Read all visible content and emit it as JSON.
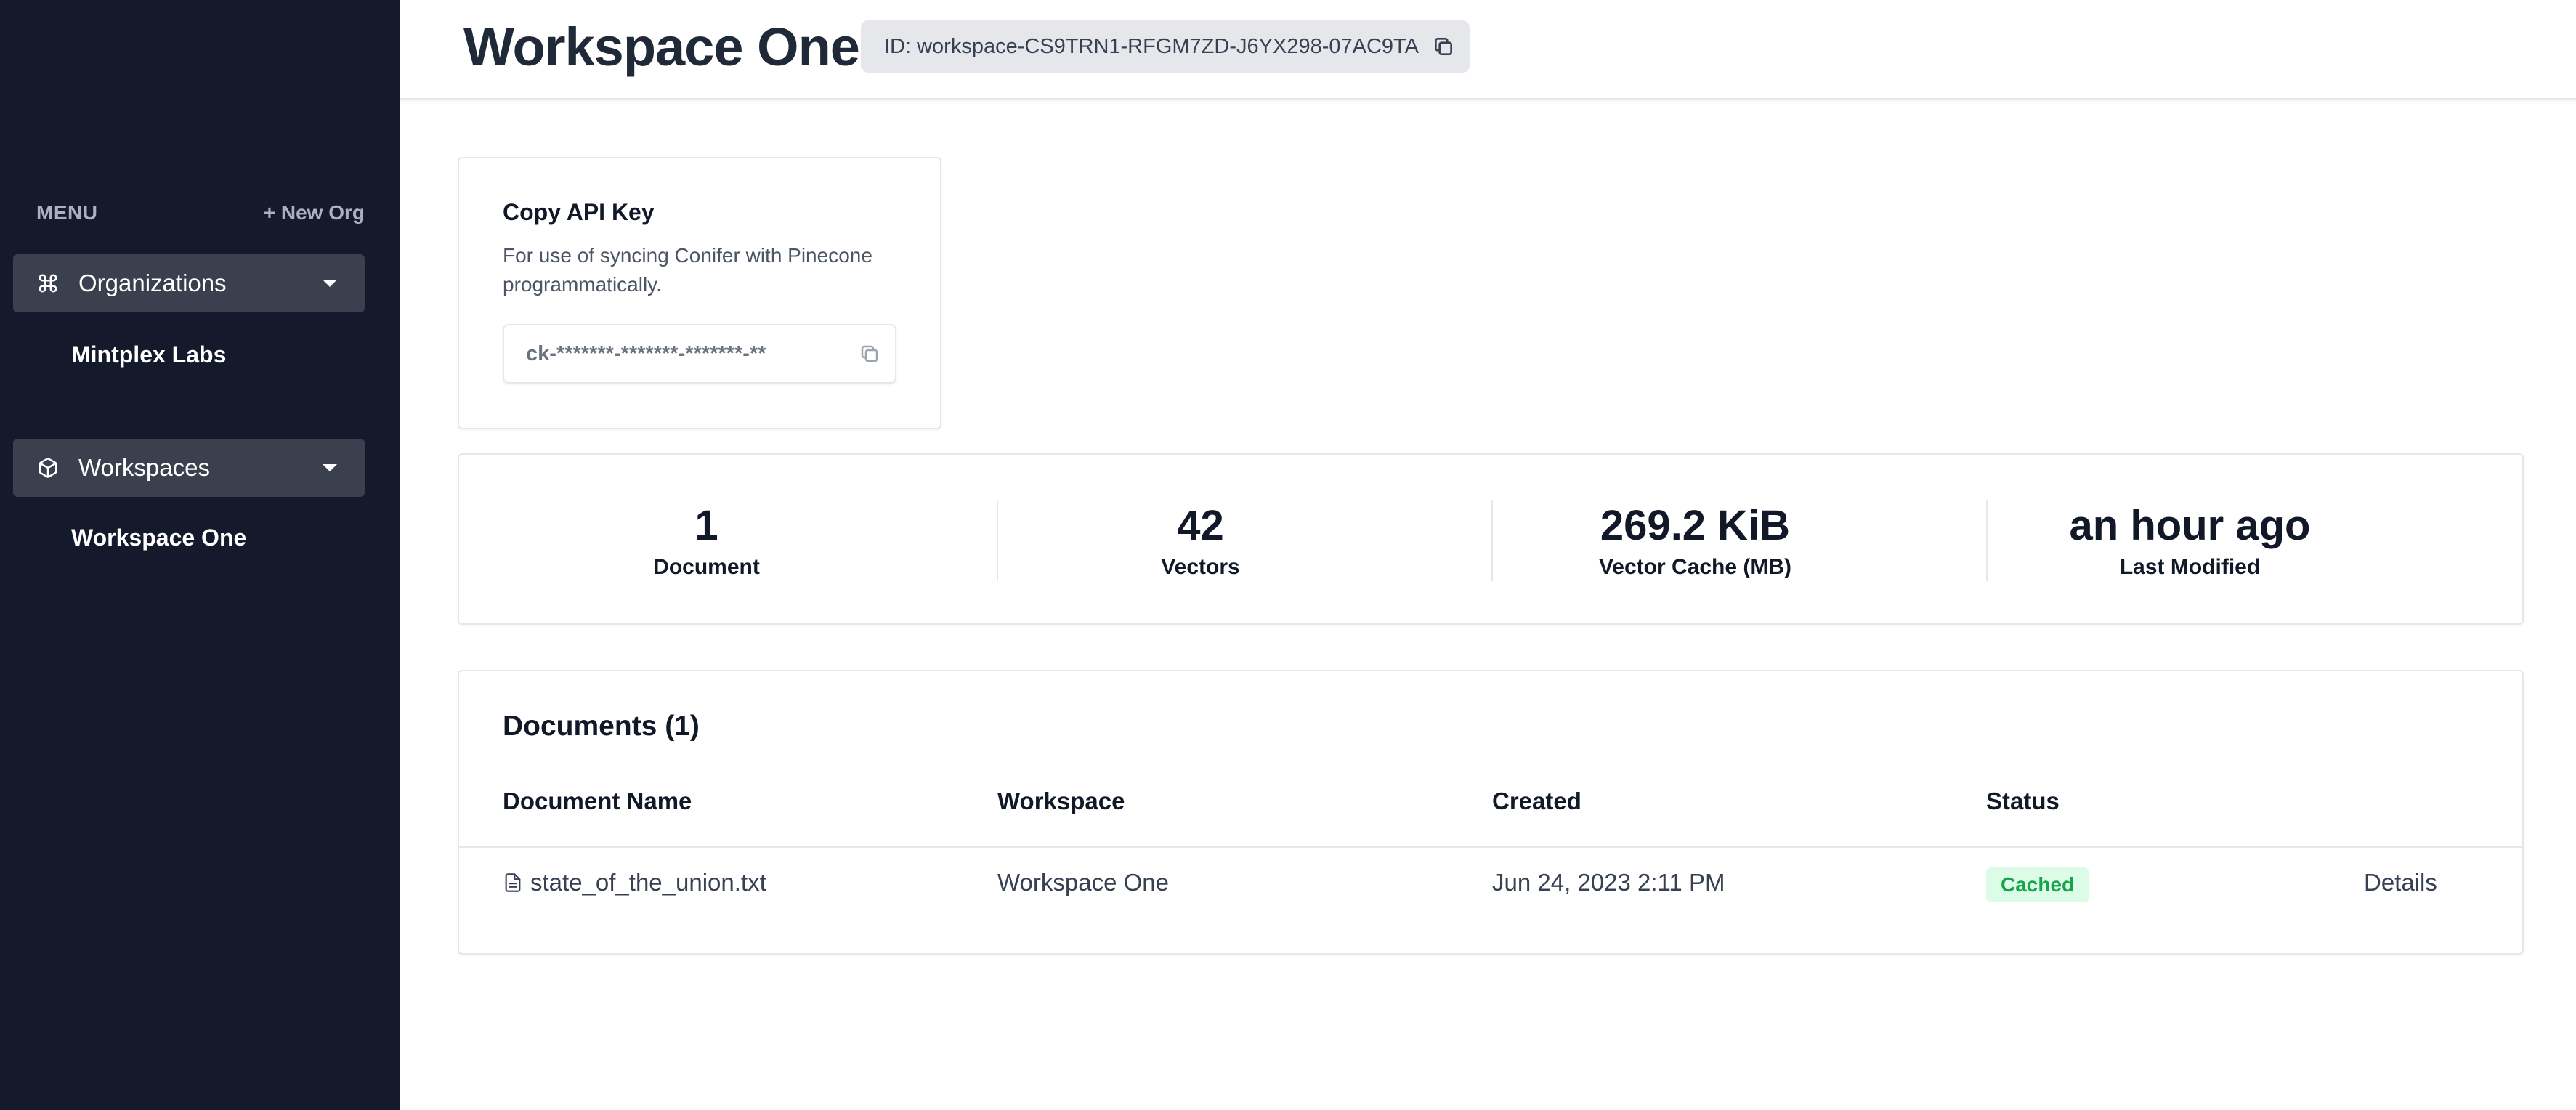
{
  "sidebar": {
    "menu_label": "MENU",
    "new_org_label": "+ New Org",
    "sections": [
      {
        "label": "Organizations",
        "icon": "command-icon",
        "items": [
          "Mintplex Labs"
        ]
      },
      {
        "label": "Workspaces",
        "icon": "cube-icon",
        "items": [
          "Workspace One"
        ]
      }
    ]
  },
  "header": {
    "title": "Workspace One",
    "id_text": "ID: workspace-CS9TRN1-RFGM7ZD-J6YX298-07AC9TA"
  },
  "api_key": {
    "title": "Copy API Key",
    "description": "For use of syncing Conifer with Pinecone programmatically.",
    "masked_value": "ck-*******-*******-*******-**"
  },
  "stats": [
    {
      "value": "1",
      "label": "Document"
    },
    {
      "value": "42",
      "label": "Vectors"
    },
    {
      "value": "269.2 KiB",
      "label": "Vector Cache (MB)"
    },
    {
      "value": "an hour ago",
      "label": "Last Modified"
    }
  ],
  "documents": {
    "title": "Documents (1)",
    "columns": [
      "Document Name",
      "Workspace",
      "Created",
      "Status"
    ],
    "rows": [
      {
        "name": "state_of_the_union.txt",
        "workspace": "Workspace One",
        "created": "Jun 24, 2023 2:11 PM",
        "status": "Cached",
        "action": "Details"
      }
    ]
  },
  "colors": {
    "sidebar_bg": "#141a2b",
    "nav_active_bg": "#3a404e",
    "badge_bg": "#dcfce7",
    "badge_text": "#16a34a"
  }
}
